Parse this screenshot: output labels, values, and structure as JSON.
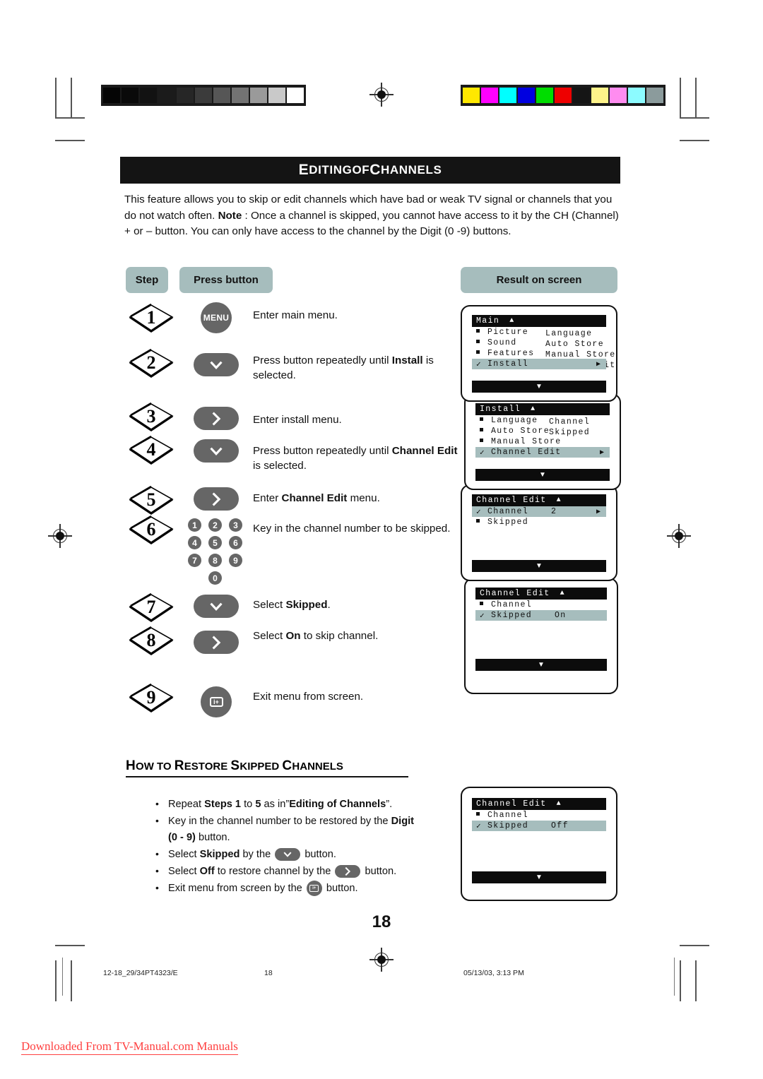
{
  "document": {
    "title_banner": {
      "lead1": "E",
      "rest1": "DITING",
      "of": " OF ",
      "lead2": "C",
      "rest2": "HANNELS"
    },
    "intro": "This feature allows you to skip or edit channels which have bad or weak TV signal or channels that you do not watch often. Note : Once a channel is skipped, you cannot have access to it by the CH (Channel) + or – button. You can only have access to the channel by the Digit (0 -9) buttons.",
    "intro_parts": {
      "p1": "This feature allows you to skip or edit channels which have bad or weak TV signal or channels that you do not watch often. ",
      "note": "Note",
      "p2": " : Once a channel is skipped, you cannot have access to it by the CH (Channel) + or – button. You can only have access to the channel by the Digit (0 -9) buttons."
    },
    "page_number": "18",
    "footer": {
      "left": "12-18_29/34PT4323/E",
      "center": "18",
      "right": "05/13/03, 3:13 PM"
    },
    "download_banner": "Downloaded From TV-Manual.com Manuals"
  },
  "table": {
    "headers": {
      "step": "Step",
      "press_button": "Press button",
      "result": "Result on screen"
    },
    "steps": [
      {
        "n": "1",
        "button": "MENU",
        "button_type": "round-text",
        "text_parts": [
          {
            "t": "Enter main menu.",
            "b": false
          }
        ]
      },
      {
        "n": "2",
        "button": "down",
        "button_type": "pill-chevron-down",
        "text_parts": [
          {
            "t": "Press button repeatedly until ",
            "b": false
          },
          {
            "t": "Install",
            "b": true
          },
          {
            "t": " is selected.",
            "b": false
          }
        ]
      },
      {
        "n": "3",
        "button": "right",
        "button_type": "pill-chevron-right",
        "text_parts": [
          {
            "t": "Enter install menu.",
            "b": false
          }
        ]
      },
      {
        "n": "4",
        "button": "down",
        "button_type": "pill-chevron-down",
        "text_parts": [
          {
            "t": "Press button repeatedly until ",
            "b": false
          },
          {
            "t": "Channel Edit",
            "b": true
          },
          {
            "t": " is selected.",
            "b": false
          }
        ]
      },
      {
        "n": "5",
        "button": "right",
        "button_type": "pill-chevron-right",
        "text_parts": [
          {
            "t": "Enter ",
            "b": false
          },
          {
            "t": "Channel Edit",
            "b": true
          },
          {
            "t": " menu.",
            "b": false
          }
        ]
      },
      {
        "n": "6",
        "button": "digits",
        "button_type": "keypad",
        "text_parts": [
          {
            "t": "Key in the channel number to be skipped.",
            "b": false
          }
        ]
      },
      {
        "n": "7",
        "button": "down",
        "button_type": "pill-chevron-down",
        "text_parts": [
          {
            "t": "Select ",
            "b": false
          },
          {
            "t": "Skipped",
            "b": true
          },
          {
            "t": ".",
            "b": false
          }
        ]
      },
      {
        "n": "8",
        "button": "right",
        "button_type": "pill-chevron-right",
        "text_parts": [
          {
            "t": "Select ",
            "b": false
          },
          {
            "t": "On",
            "b": true
          },
          {
            "t": " to skip channel.",
            "b": false
          }
        ]
      },
      {
        "n": "9",
        "button": "i+",
        "button_type": "round-info",
        "text_parts": [
          {
            "t": "Exit menu from screen.",
            "b": false
          }
        ]
      }
    ],
    "keypad_rows": [
      [
        "1",
        "2",
        "3"
      ],
      [
        "4",
        "5",
        "6"
      ],
      [
        "7",
        "8",
        "9"
      ],
      [
        "",
        "0",
        ""
      ]
    ]
  },
  "osd_screens": [
    {
      "id": "main",
      "title": "Main",
      "rows": [
        {
          "mark": "square",
          "label": "Picture",
          "highlight": false,
          "value": "",
          "arrow": false
        },
        {
          "mark": "square",
          "label": "Sound",
          "highlight": false,
          "value": "",
          "arrow": false
        },
        {
          "mark": "square",
          "label": "Features",
          "highlight": false,
          "value": "",
          "arrow": false
        },
        {
          "mark": "check",
          "label": "Install",
          "highlight": true,
          "value": "",
          "arrow": true
        }
      ],
      "column2": [
        "Language",
        "Auto Store",
        "Manual Store",
        "Channel Edit"
      ],
      "bottom_arrow": "▼"
    },
    {
      "id": "install",
      "title": "Install",
      "rows": [
        {
          "mark": "square",
          "label": "Language",
          "highlight": false,
          "value": "",
          "arrow": false
        },
        {
          "mark": "square",
          "label": "Auto Store",
          "highlight": false,
          "value": "",
          "arrow": false
        },
        {
          "mark": "square",
          "label": "Manual Store",
          "highlight": false,
          "value": "",
          "arrow": false
        },
        {
          "mark": "check",
          "label": "Channel Edit",
          "highlight": true,
          "value": "",
          "arrow": true
        }
      ],
      "column2": [
        "Channel",
        "Skipped"
      ],
      "bottom_arrow": "▼"
    },
    {
      "id": "channel-edit-number",
      "title": "Channel Edit",
      "rows": [
        {
          "mark": "check",
          "label": "Channel",
          "highlight": true,
          "value": "2",
          "arrow": true
        },
        {
          "mark": "square",
          "label": "Skipped",
          "highlight": false,
          "value": "",
          "arrow": false
        }
      ],
      "column2": [],
      "bottom_arrow": "▼"
    },
    {
      "id": "channel-edit-skipped-on",
      "title": "Channel Edit",
      "rows": [
        {
          "mark": "square",
          "label": "Channel",
          "highlight": false,
          "value": "",
          "arrow": false
        },
        {
          "mark": "check",
          "label": "Skipped",
          "highlight": true,
          "value": "On",
          "arrow": false
        }
      ],
      "column2": [],
      "bottom_arrow": "▼"
    }
  ],
  "restore_section": {
    "heading": {
      "lead1": "H",
      "rest1": "OW",
      "to": " TO ",
      "lead2": "R",
      "rest2": "ESTORE ",
      "lead3": "S",
      "rest3": "KIPPED ",
      "lead4": "C",
      "rest4": "HANNELS"
    },
    "heading_plain": "HOW TO RESTORE SKIPPED CHANNELS",
    "bullets": [
      {
        "parts": [
          {
            "t": "Repeat ",
            "b": false
          },
          {
            "t": "Steps 1",
            "b": true
          },
          {
            "t": " to ",
            "b": false
          },
          {
            "t": "5",
            "b": true
          },
          {
            "t": " as in”",
            "b": false
          },
          {
            "t": "Editing of Channels",
            "b": true
          },
          {
            "t": "”.",
            "b": false
          }
        ],
        "icon": ""
      },
      {
        "parts": [
          {
            "t": "Key in the channel number to be restored by the ",
            "b": false
          },
          {
            "t": "Digit (0 - 9)",
            "b": true
          },
          {
            "t": " button.",
            "b": false
          }
        ],
        "icon": ""
      },
      {
        "parts": [
          {
            "t": "Select ",
            "b": false
          },
          {
            "t": "Skipped",
            "b": true
          },
          {
            "t": " by the ",
            "b": false
          }
        ],
        "icon": "down",
        "tail": " button."
      },
      {
        "parts": [
          {
            "t": "Select ",
            "b": false
          },
          {
            "t": "Off",
            "b": true
          },
          {
            "t": " to restore channel by the ",
            "b": false
          }
        ],
        "icon": "right",
        "tail": " button."
      },
      {
        "parts": [
          {
            "t": "Exit menu from screen by the ",
            "b": false
          }
        ],
        "icon": "info",
        "tail": "  button."
      }
    ],
    "osd": {
      "id": "channel-edit-skipped-off",
      "title": "Channel Edit",
      "rows": [
        {
          "mark": "square",
          "label": "Channel",
          "highlight": false,
          "value": "",
          "arrow": false
        },
        {
          "mark": "check",
          "label": "Skipped",
          "highlight": true,
          "value": "Off",
          "arrow": false
        }
      ],
      "bottom_arrow": "▼"
    }
  },
  "print_marks": {
    "grayscale_bar": [
      "#050505",
      "#0a0a0a",
      "#121212",
      "#1b1b1b",
      "#262626",
      "#3b3b3b",
      "#565656",
      "#737373",
      "#9a9a9a",
      "#c9c9c9",
      "#ffffff"
    ],
    "color_bar": [
      "#ffe800",
      "#ff00ff",
      "#00ffff",
      "#0000e0",
      "#00dd00",
      "#ee0000",
      "#151515",
      "#fff48a",
      "#ff8cf0",
      "#8cfbff",
      "#8b9b9c"
    ]
  },
  "colors": {
    "accent_teal": "#a6bdbd",
    "button_gray": "#666666",
    "banner_black": "#141414",
    "banner_red": "#ff4040"
  }
}
